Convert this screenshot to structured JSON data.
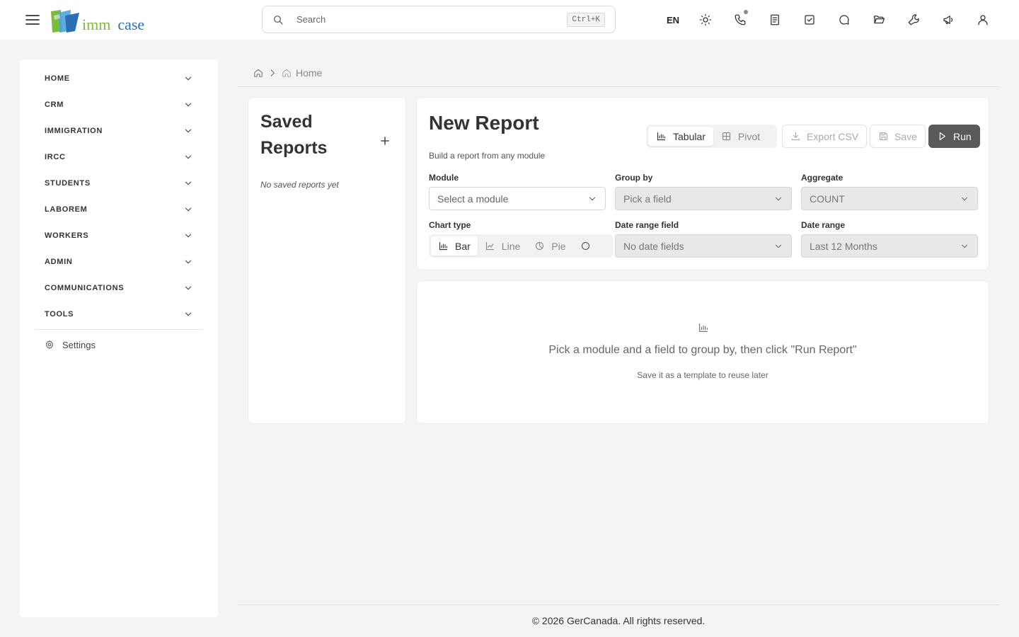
{
  "header": {
    "logo": {
      "imm": "imm",
      "case": "case"
    },
    "search": {
      "placeholder": "Search",
      "shortcut": "Ctrl+K"
    },
    "language": "EN",
    "icons": [
      "sun-icon",
      "phone-icon",
      "notes-icon",
      "tasks-icon",
      "chat-icon",
      "folder-icon",
      "wrench-icon",
      "megaphone-icon",
      "user-icon"
    ]
  },
  "sidebar": {
    "items": [
      {
        "label": "HOME"
      },
      {
        "label": "CRM"
      },
      {
        "label": "IMMIGRATION"
      },
      {
        "label": "IRCC"
      },
      {
        "label": "STUDENTS"
      },
      {
        "label": "LABOREM"
      },
      {
        "label": "WORKERS"
      },
      {
        "label": "ADMIN"
      },
      {
        "label": "COMMUNICATIONS"
      },
      {
        "label": "TOOLS"
      }
    ],
    "settings_label": "Settings"
  },
  "breadcrumb": {
    "home_label": "Home"
  },
  "saved_reports": {
    "title": "Saved Reports",
    "empty_text": "No saved reports yet"
  },
  "report": {
    "title": "New Report",
    "subtitle": "Build a report from any module",
    "views": {
      "tabular": "Tabular",
      "pivot": "Pivot",
      "active": "Tabular"
    },
    "actions": {
      "export": "Export CSV",
      "save": "Save",
      "run": "Run"
    },
    "module": {
      "label": "Module",
      "placeholder": "Select a module"
    },
    "group_by": {
      "label": "Group by",
      "placeholder": "Pick a field"
    },
    "aggregate": {
      "label": "Aggregate",
      "value": "COUNT"
    },
    "chart_type": {
      "label": "Chart type",
      "options": [
        "Bar",
        "Line",
        "Pie"
      ],
      "selected": "Bar"
    },
    "date_range_field": {
      "label": "Date range field",
      "placeholder": "No date fields"
    },
    "date_range": {
      "label": "Date range",
      "value": "Last 12 Months"
    }
  },
  "empty_state": {
    "message": "Pick a module and a field to group by, then click \"Run Report\"",
    "sub": "Save it as a template to reuse later"
  },
  "footer": {
    "text": "© 2026 GerCanada. All rights reserved."
  },
  "colors": {
    "run_button": "#595959",
    "logo_green": "#7dbb3c",
    "logo_blue": "#2a6fb5",
    "background": "#f4f4f4"
  }
}
